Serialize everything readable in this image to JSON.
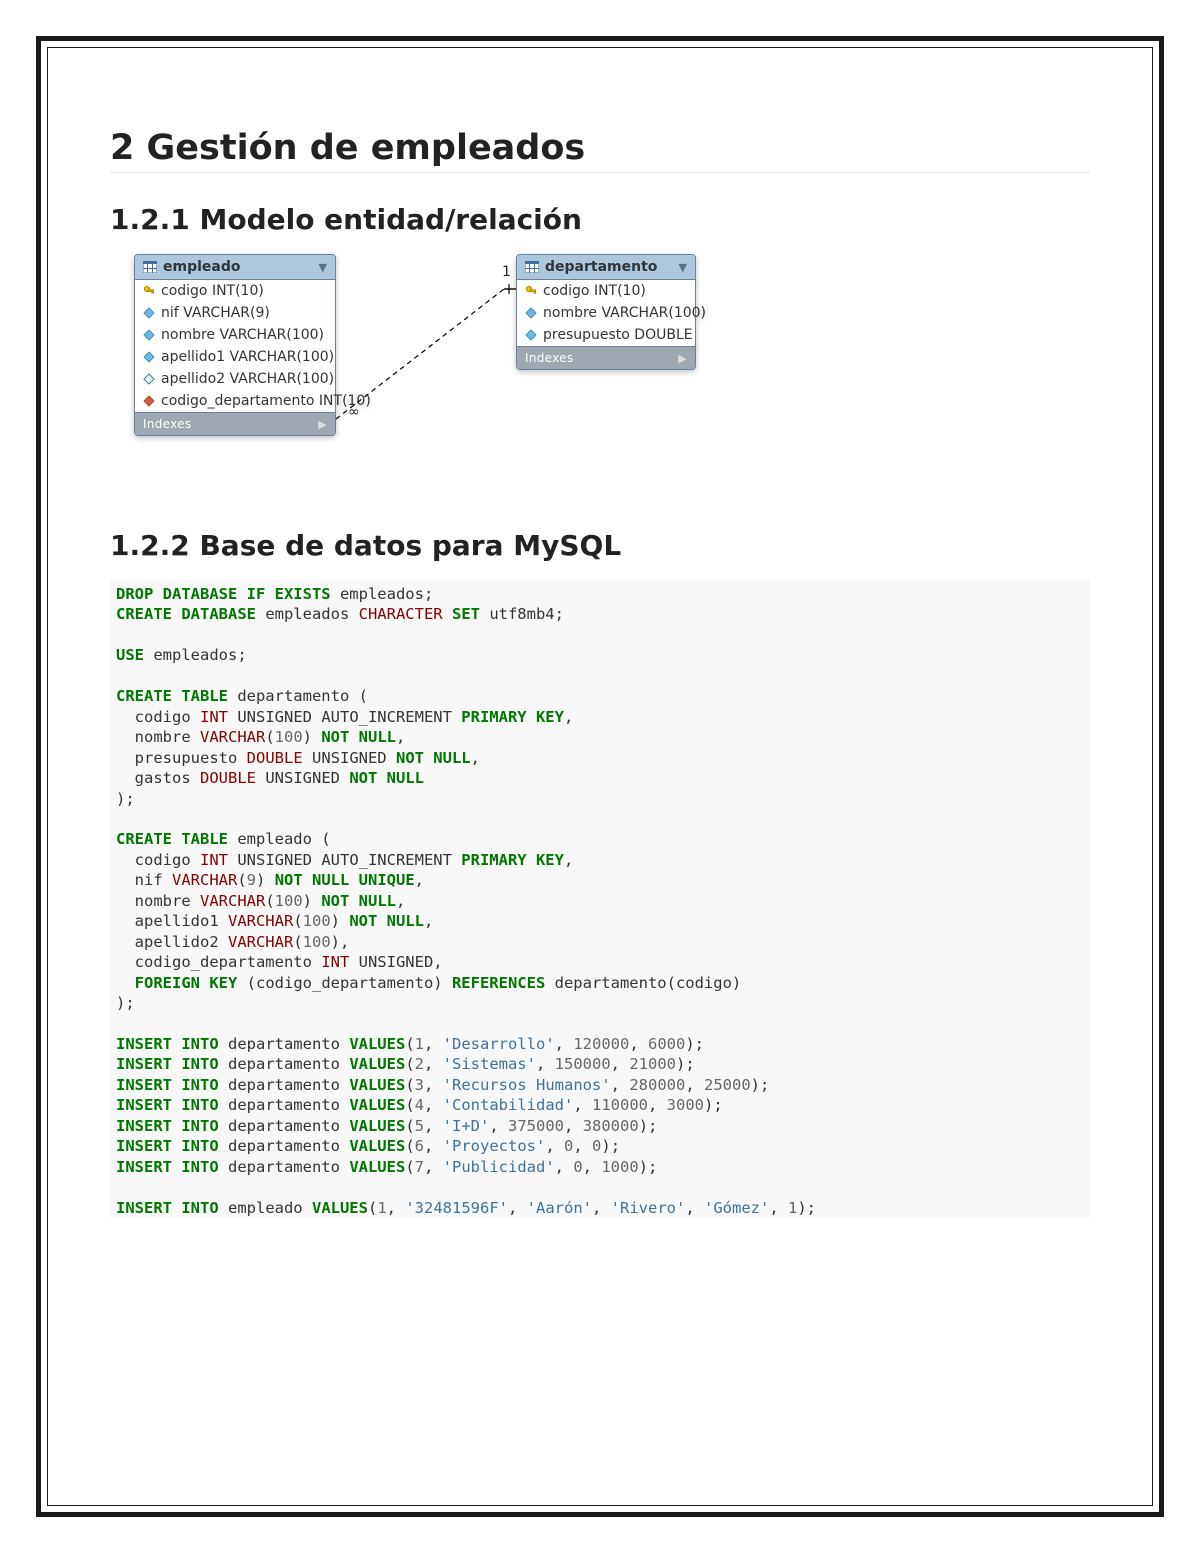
{
  "headings": {
    "h1": "2 Gestión de empleados",
    "h2_er": "1.2.1 Modelo entidad/relación",
    "h2_sql": "1.2.2 Base de datos para MySQL"
  },
  "er": {
    "empleado": {
      "title": "empleado",
      "rows": [
        {
          "icon": "key",
          "text": "codigo INT(10)"
        },
        {
          "icon": "filled",
          "text": "nif VARCHAR(9)"
        },
        {
          "icon": "filled",
          "text": "nombre VARCHAR(100)"
        },
        {
          "icon": "filled",
          "text": "apellido1 VARCHAR(100)"
        },
        {
          "icon": "hollow",
          "text": "apellido2 VARCHAR(100)"
        },
        {
          "icon": "fk",
          "text": "codigo_departamento INT(10)"
        }
      ],
      "footer": "Indexes"
    },
    "departamento": {
      "title": "departamento",
      "rows": [
        {
          "icon": "key",
          "text": "codigo INT(10)"
        },
        {
          "icon": "filled",
          "text": "nombre VARCHAR(100)"
        },
        {
          "icon": "filled",
          "text": "presupuesto DOUBLE"
        }
      ],
      "footer": "Indexes"
    },
    "cardinality": {
      "many": "∞",
      "one": "1"
    }
  },
  "sql": {
    "drop_database": {
      "cmd": "DROP DATABASE IF EXISTS",
      "name": "empleados"
    },
    "create_database": {
      "cmd_a": "CREATE DATABASE",
      "name": "empleados",
      "cs_kw": "CHARACTER",
      "set_kw": "SET",
      "charset": "utf8mb4"
    },
    "use": {
      "cmd": "USE",
      "name": "empleados"
    },
    "create_dept": {
      "cmd": "CREATE TABLE",
      "name": "departamento",
      "cols": [
        {
          "name": "codigo",
          "type": "INT",
          "extra": "UNSIGNED AUTO_INCREMENT",
          "constraint": "PRIMARY KEY"
        },
        {
          "name": "nombre",
          "type": "VARCHAR",
          "len": "100",
          "constraint": "NOT NULL"
        },
        {
          "name": "presupuesto",
          "type": "DOUBLE",
          "extra": "UNSIGNED",
          "constraint": "NOT NULL"
        },
        {
          "name": "gastos",
          "type": "DOUBLE",
          "extra": "UNSIGNED",
          "constraint": "NOT NULL"
        }
      ]
    },
    "create_emp": {
      "cmd": "CREATE TABLE",
      "name": "empleado",
      "cols": [
        {
          "name": "codigo",
          "type": "INT",
          "extra": "UNSIGNED AUTO_INCREMENT",
          "constraint": "PRIMARY KEY"
        },
        {
          "name": "nif",
          "type": "VARCHAR",
          "len": "9",
          "constraint": "NOT NULL UNIQUE"
        },
        {
          "name": "nombre",
          "type": "VARCHAR",
          "len": "100",
          "constraint": "NOT NULL"
        },
        {
          "name": "apellido1",
          "type": "VARCHAR",
          "len": "100",
          "constraint": "NOT NULL"
        },
        {
          "name": "apellido2",
          "type": "VARCHAR",
          "len": "100"
        },
        {
          "name": "codigo_departamento",
          "type": "INT",
          "extra": "UNSIGNED"
        }
      ],
      "fk": {
        "kw1": "FOREIGN KEY",
        "col": "codigo_departamento",
        "kw2": "REFERENCES",
        "ref": "departamento(codigo)"
      }
    },
    "insert_dept_into": "INSERT INTO",
    "insert_dept_values": "VALUES",
    "dept_inserts": [
      {
        "id": "1",
        "name": "Desarrollo",
        "p": "120000",
        "g": "6000"
      },
      {
        "id": "2",
        "name": "Sistemas",
        "p": "150000",
        "g": "21000"
      },
      {
        "id": "3",
        "name": "Recursos Humanos",
        "p": "280000",
        "g": "25000"
      },
      {
        "id": "4",
        "name": "Contabilidad",
        "p": "110000",
        "g": "3000"
      },
      {
        "id": "5",
        "name": "I+D",
        "p": "375000",
        "g": "380000"
      },
      {
        "id": "6",
        "name": "Proyectos",
        "p": "0",
        "g": "0"
      },
      {
        "id": "7",
        "name": "Publicidad",
        "p": "0",
        "g": "1000"
      }
    ],
    "emp_insert": {
      "into": "INSERT INTO",
      "table": "empleado",
      "values": "VALUES",
      "row": {
        "id": "1",
        "nif": "32481596F",
        "nombre": "Aarón",
        "ap1": "Rivero",
        "ap2": "Gómez",
        "dep": "1"
      }
    }
  }
}
